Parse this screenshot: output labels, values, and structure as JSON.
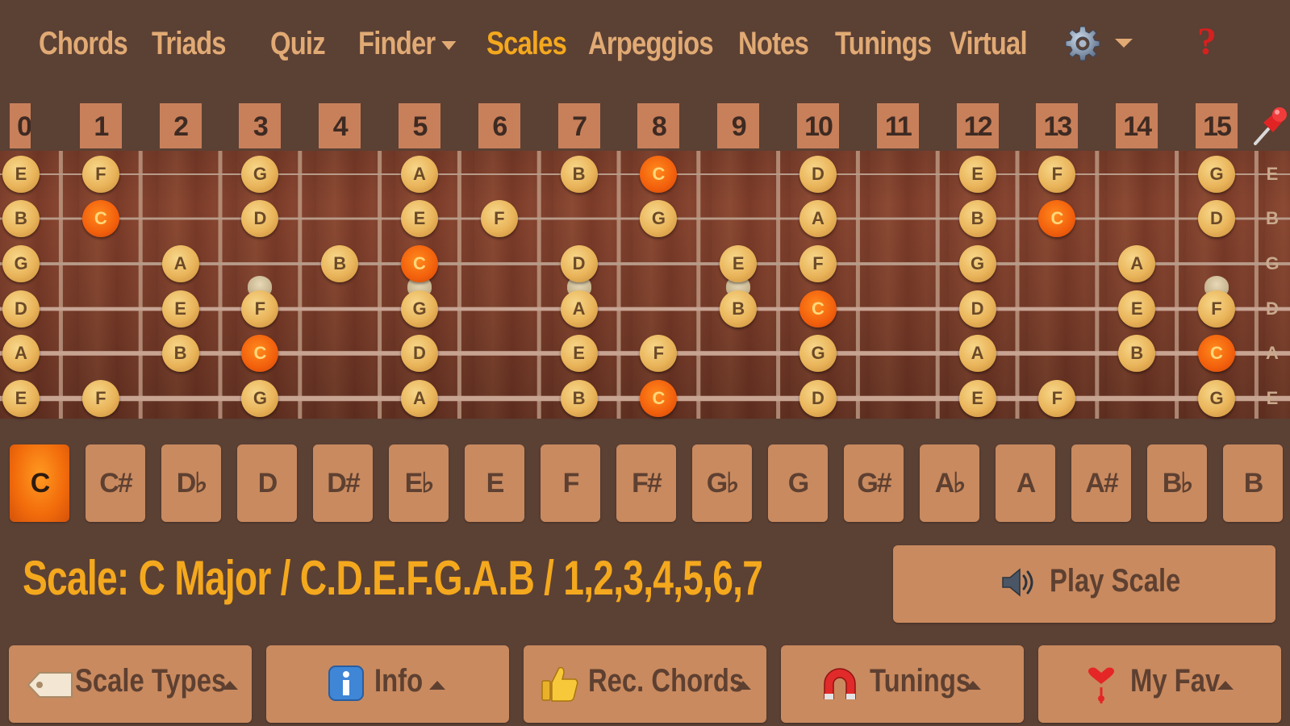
{
  "nav": {
    "items": [
      {
        "label": "Chords",
        "active": false
      },
      {
        "label": "Triads",
        "active": false
      },
      {
        "label": "Quiz",
        "active": false
      },
      {
        "label": "Finder",
        "active": false,
        "dropdown": true
      },
      {
        "label": "Scales",
        "active": true
      },
      {
        "label": "Arpeggios",
        "active": false
      },
      {
        "label": "Notes",
        "active": false
      },
      {
        "label": "Tunings",
        "active": false
      },
      {
        "label": "Virtual",
        "active": false
      }
    ],
    "help_label": "?"
  },
  "fretboard": {
    "fret_numbers": [
      "0",
      "1",
      "2",
      "3",
      "4",
      "5",
      "6",
      "7",
      "8",
      "9",
      "10",
      "11",
      "12",
      "13",
      "14",
      "15"
    ],
    "string_labels": [
      "E",
      "B",
      "G",
      "D",
      "A",
      "E"
    ],
    "root_note": "C",
    "strings": [
      {
        "name": "E",
        "notes": [
          {
            "fret": 0,
            "note": "E"
          },
          {
            "fret": 1,
            "note": "F"
          },
          {
            "fret": 3,
            "note": "G"
          },
          {
            "fret": 5,
            "note": "A"
          },
          {
            "fret": 7,
            "note": "B"
          },
          {
            "fret": 8,
            "note": "C"
          },
          {
            "fret": 10,
            "note": "D"
          },
          {
            "fret": 12,
            "note": "E"
          },
          {
            "fret": 13,
            "note": "F"
          },
          {
            "fret": 15,
            "note": "G"
          }
        ]
      },
      {
        "name": "B",
        "notes": [
          {
            "fret": 0,
            "note": "B"
          },
          {
            "fret": 1,
            "note": "C"
          },
          {
            "fret": 3,
            "note": "D"
          },
          {
            "fret": 5,
            "note": "E"
          },
          {
            "fret": 6,
            "note": "F"
          },
          {
            "fret": 8,
            "note": "G"
          },
          {
            "fret": 10,
            "note": "A"
          },
          {
            "fret": 12,
            "note": "B"
          },
          {
            "fret": 13,
            "note": "C"
          },
          {
            "fret": 15,
            "note": "D"
          }
        ]
      },
      {
        "name": "G",
        "notes": [
          {
            "fret": 0,
            "note": "G"
          },
          {
            "fret": 2,
            "note": "A"
          },
          {
            "fret": 4,
            "note": "B"
          },
          {
            "fret": 5,
            "note": "C"
          },
          {
            "fret": 7,
            "note": "D"
          },
          {
            "fret": 9,
            "note": "E"
          },
          {
            "fret": 10,
            "note": "F"
          },
          {
            "fret": 12,
            "note": "G"
          },
          {
            "fret": 14,
            "note": "A"
          }
        ]
      },
      {
        "name": "D",
        "notes": [
          {
            "fret": 0,
            "note": "D"
          },
          {
            "fret": 2,
            "note": "E"
          },
          {
            "fret": 3,
            "note": "F"
          },
          {
            "fret": 5,
            "note": "G"
          },
          {
            "fret": 7,
            "note": "A"
          },
          {
            "fret": 9,
            "note": "B"
          },
          {
            "fret": 10,
            "note": "C"
          },
          {
            "fret": 12,
            "note": "D"
          },
          {
            "fret": 14,
            "note": "E"
          },
          {
            "fret": 15,
            "note": "F"
          }
        ]
      },
      {
        "name": "A",
        "notes": [
          {
            "fret": 0,
            "note": "A"
          },
          {
            "fret": 2,
            "note": "B"
          },
          {
            "fret": 3,
            "note": "C"
          },
          {
            "fret": 5,
            "note": "D"
          },
          {
            "fret": 7,
            "note": "E"
          },
          {
            "fret": 8,
            "note": "F"
          },
          {
            "fret": 10,
            "note": "G"
          },
          {
            "fret": 12,
            "note": "A"
          },
          {
            "fret": 14,
            "note": "B"
          },
          {
            "fret": 15,
            "note": "C"
          }
        ]
      },
      {
        "name": "E",
        "notes": [
          {
            "fret": 0,
            "note": "E"
          },
          {
            "fret": 1,
            "note": "F"
          },
          {
            "fret": 3,
            "note": "G"
          },
          {
            "fret": 5,
            "note": "A"
          },
          {
            "fret": 7,
            "note": "B"
          },
          {
            "fret": 8,
            "note": "C"
          },
          {
            "fret": 10,
            "note": "D"
          },
          {
            "fret": 12,
            "note": "E"
          },
          {
            "fret": 13,
            "note": "F"
          },
          {
            "fret": 15,
            "note": "G"
          }
        ]
      }
    ],
    "inlay_frets": [
      3,
      5,
      7,
      9,
      15
    ]
  },
  "keys": {
    "selected": "C",
    "options": [
      "C",
      "C#",
      "D♭",
      "D",
      "D#",
      "E♭",
      "E",
      "F",
      "F#",
      "G♭",
      "G",
      "G#",
      "A♭",
      "A",
      "A#",
      "B♭",
      "B"
    ]
  },
  "scale": {
    "text": "Scale: C Major / C.D.E.F.G.A.B / 1,2,3,4,5,6,7",
    "play_label": "Play Scale"
  },
  "toolbar": {
    "items": [
      {
        "label": "Scale Types",
        "icon": "tag-icon"
      },
      {
        "label": "Info",
        "icon": "info-icon"
      },
      {
        "label": "Rec. Chords",
        "icon": "thumbs-up-icon"
      },
      {
        "label": "Tunings",
        "icon": "magnet-icon"
      },
      {
        "label": "My Fav",
        "icon": "heart-icon"
      }
    ]
  },
  "colors": {
    "background": "#5b4034",
    "accent": "#f4a81d",
    "button": "#c98a5f",
    "root_dot": "#f25f0c",
    "note_dot": "#e9b45a"
  }
}
